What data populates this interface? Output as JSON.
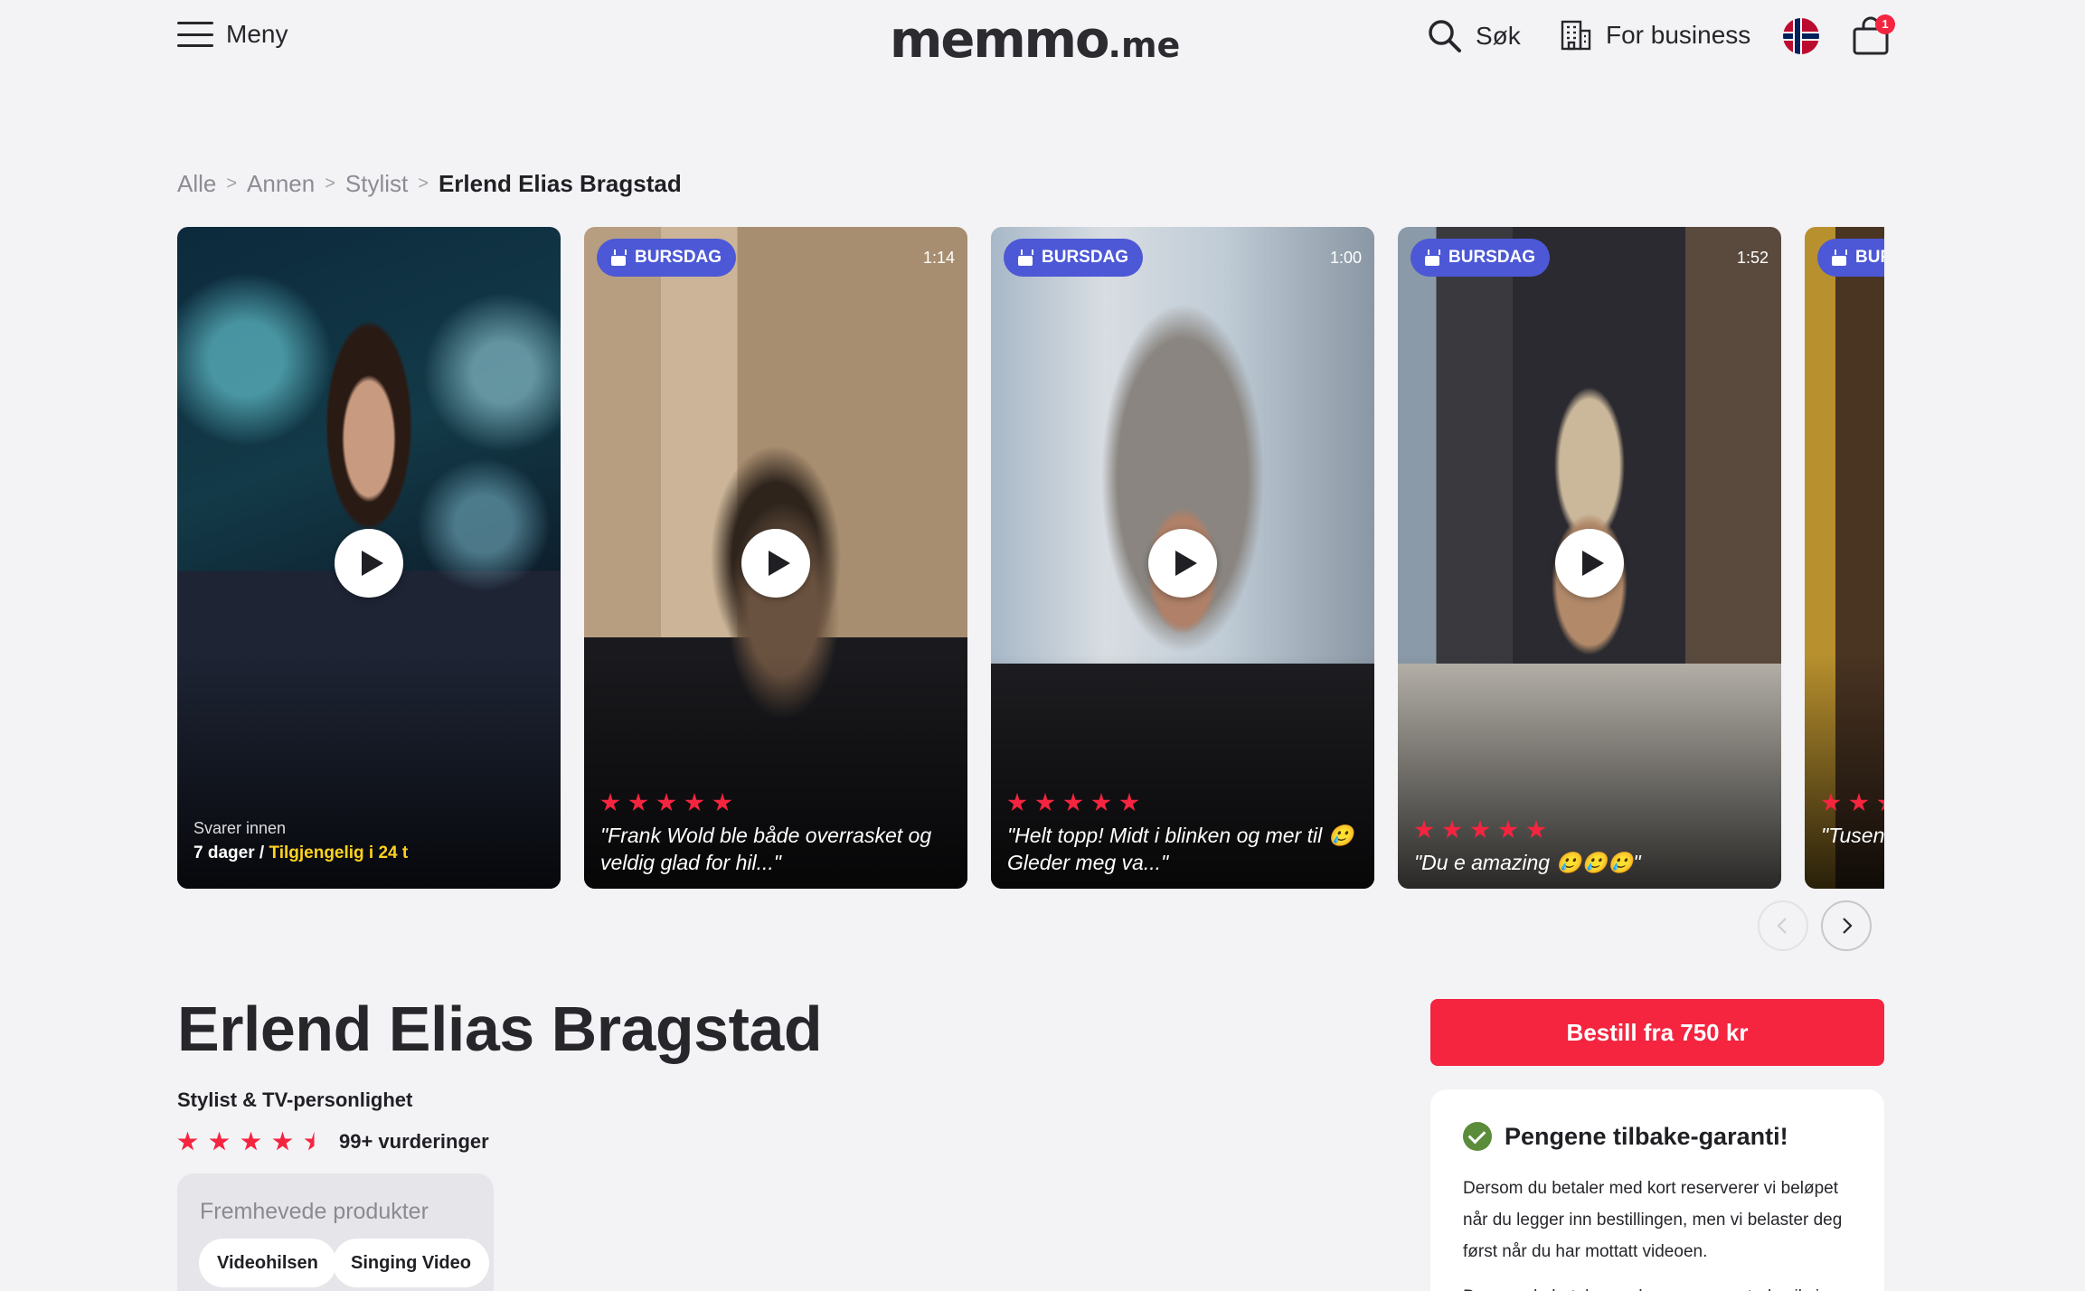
{
  "header": {
    "menu_label": "Meny",
    "logo_main": "memmo",
    "logo_tld": ".me",
    "search_label": "Søk",
    "business_label": "For business",
    "flag": "norway-flag-icon",
    "cart_count": "1"
  },
  "breadcrumb": {
    "items": [
      "Alle",
      "Annen",
      "Stylist"
    ],
    "current": "Erlend Elias Bragstad"
  },
  "carousel": {
    "intro": {
      "responds_label": "Svarer innen",
      "responds_value": "7 dager /",
      "available": "Tilgjengelig i 24 t"
    },
    "videos": [
      {
        "tag": "BURSDAG",
        "duration": "1:14",
        "rating": 5,
        "quote": "\"Frank Wold ble både overrasket og veldig glad for hil...\""
      },
      {
        "tag": "BURSDAG",
        "duration": "1:00",
        "rating": 5,
        "quote": "\"Helt topp! Midt i blinken og mer til 🥲 Gleder meg va...\""
      },
      {
        "tag": "BURSDAG",
        "duration": "1:52",
        "rating": 5,
        "quote": "\"Du e amazing 🥲🥲🥲\""
      },
      {
        "tag": "BURSDAG",
        "duration": "",
        "rating": 5,
        "quote": "\"Tusen takk, veldig glad\""
      }
    ]
  },
  "profile": {
    "name": "Erlend Elias Bragstad",
    "subtitle": "Stylist & TV-personlighet",
    "rating": 4.5,
    "rating_text": "99+ vurderinger",
    "featured_title": "Fremhevede produkter",
    "featured_products": [
      "Videohilsen",
      "Singing Video"
    ]
  },
  "order": {
    "button_label": "Bestill fra 750 kr",
    "guarantee_title": "Pengene tilbake-garanti!",
    "guarantee_text": "Dersom du betaler med kort reserverer vi beløpet når du legger inn bestillingen, men vi belaster deg først når du har mottatt videoen.",
    "guarantee_more": "Dersom du betaler med en annen metode vil vi"
  },
  "colors": {
    "accent": "#f5243f",
    "tag": "#4c58d6",
    "available": "#ffd21f",
    "background": "#f3f3f6"
  }
}
